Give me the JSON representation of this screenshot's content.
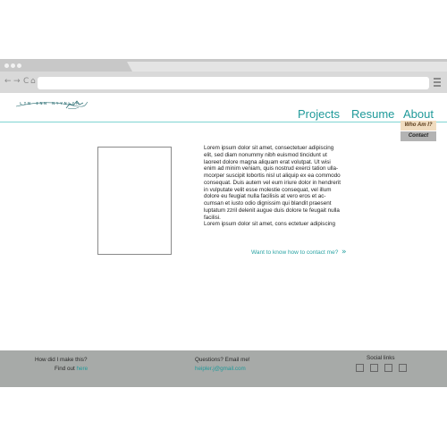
{
  "browser": {
    "nav_back": "←",
    "nav_forward": "→",
    "nav_reload": "C",
    "nav_home": "⌂",
    "url": ""
  },
  "site": {
    "logo_text": "ʟɪɴ ɪɴɴ ɴʏʏɴʟɛʀ",
    "nav": [
      "Projects",
      "Resume",
      "About"
    ],
    "dropdown": [
      "Who Am I?",
      "Contact"
    ]
  },
  "content": {
    "lorem": "Lorem ipsum dolor sit amet, consectetuer adipiscing\nelit, sed diam nonummy nibh euismod tincidunt ut\nlaoreet dolore magna aliquam erat volutpat. Ut wisi\nenim ad minim veniam, quis nostrud exerci tation ulla-\nmcorper suscipit lobortis nisl ut aliquip ex ea commodo\nconsequat. Duis autem vel eum iriure dolor in hendrerit\nin vulputate velit esse molestie consequat, vel illum\ndolore eu feugiat nulla facilisis at vero eros et ac-\ncumsan et iusto odio dignissim qui blandit praesent\nluptatum zzril delenit augue duis dolore te feugait nulla\nfacilisi.\nLorem ipsum dolor sit amet, cons ectetuer adipiscing",
    "contact_link": "Want to know how to contact me?",
    "contact_chevron": "»"
  },
  "footer": {
    "how_made": "How did I make this?",
    "find_out": "Find out ",
    "find_out_link": "here",
    "questions": "Questions? Email me!",
    "email": "heipler.j@gmail.com",
    "social_label": "Social links"
  }
}
